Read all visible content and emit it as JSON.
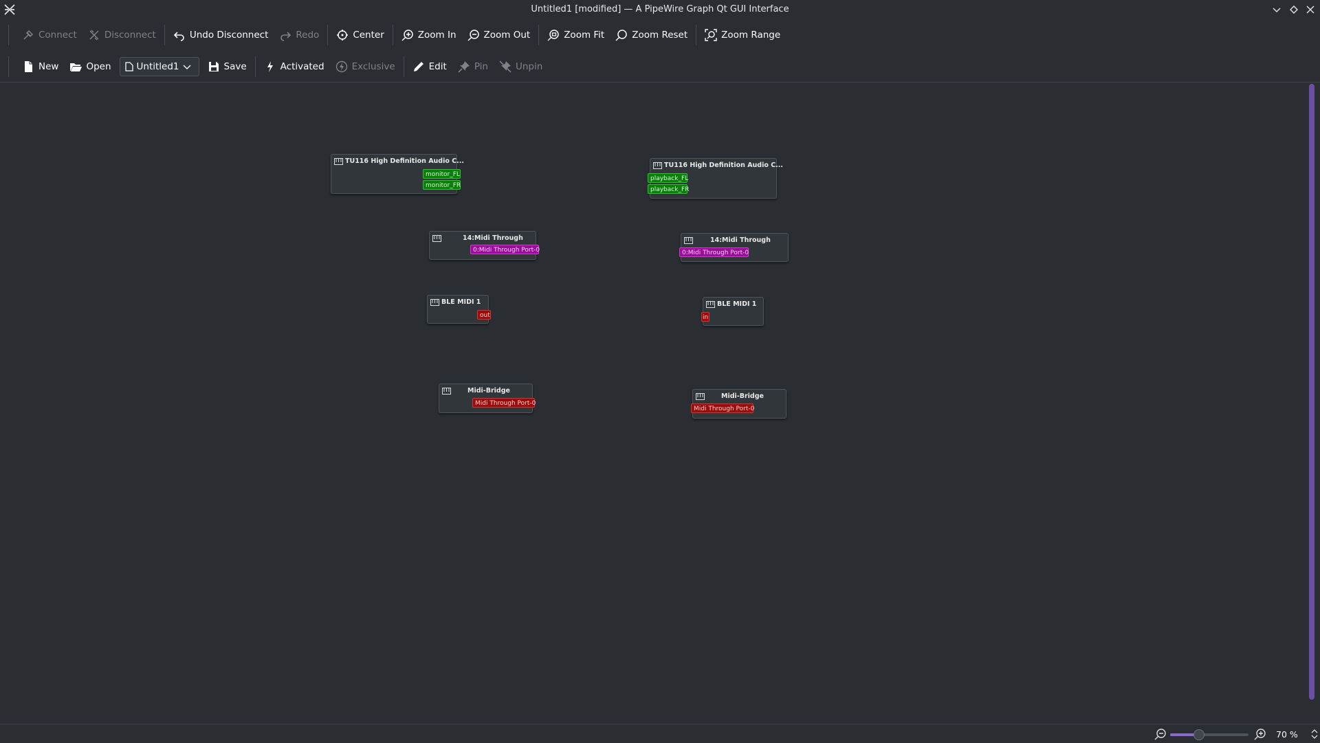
{
  "window": {
    "title": "Untitled1 [modified] — A PipeWire Graph Qt GUI Interface"
  },
  "toolbar1": [
    {
      "label": "Connect",
      "icon": "connect-icon",
      "enabled": false
    },
    {
      "label": "Disconnect",
      "icon": "disconnect-icon",
      "enabled": false
    },
    {
      "label": "Undo Disconnect",
      "icon": "undo-icon",
      "enabled": true
    },
    {
      "label": "Redo",
      "icon": "redo-icon",
      "enabled": false
    },
    {
      "label": "Center",
      "icon": "center-icon",
      "enabled": true
    },
    {
      "label": "Zoom In",
      "icon": "zoom-in-icon",
      "enabled": true
    },
    {
      "label": "Zoom Out",
      "icon": "zoom-out-icon",
      "enabled": true
    },
    {
      "label": "Zoom Fit",
      "icon": "zoom-fit-icon",
      "enabled": true
    },
    {
      "label": "Zoom Reset",
      "icon": "zoom-reset-icon",
      "enabled": true
    },
    {
      "label": "Zoom Range",
      "icon": "zoom-range-icon",
      "enabled": true
    }
  ],
  "toolbar2": {
    "new_label": "New",
    "open_label": "Open",
    "patchbay_selected": "Untitled1",
    "save_label": "Save",
    "activated_label": "Activated",
    "exclusive_label": "Exclusive",
    "edit_label": "Edit",
    "pin_label": "Pin",
    "unpin_label": "Unpin"
  },
  "nodes": {
    "audio_out": {
      "title": "TU116 High Definition Audio C...",
      "ports": [
        "monitor_FL",
        "monitor_FR"
      ]
    },
    "audio_in": {
      "title": "TU116 High Definition Audio C...",
      "ports": [
        "playback_FL",
        "playback_FR"
      ]
    },
    "midi_through_out": {
      "title": "14:Midi Through",
      "ports": [
        "0:Midi Through Port-0"
      ]
    },
    "midi_through_in": {
      "title": "14:Midi Through",
      "ports": [
        "0:Midi Through Port-0"
      ]
    },
    "ble_out": {
      "title": "BLE MIDI 1",
      "ports": [
        "out"
      ]
    },
    "ble_in": {
      "title": "BLE MIDI 1",
      "ports": [
        "in"
      ]
    },
    "bridge_out": {
      "title": "Midi-Bridge",
      "ports": [
        "Midi Through Port-0"
      ]
    },
    "bridge_in": {
      "title": "Midi-Bridge",
      "ports": [
        "Midi Through Port-0"
      ]
    }
  },
  "status": {
    "zoom_text": "70 %",
    "zoom_value": 70
  },
  "colors": {
    "audio_port": "#0e7d0e",
    "midi_port": "#9a0f9a",
    "midi_bridge_port": "#9a0d0d",
    "accent": "#8a6ad0"
  }
}
